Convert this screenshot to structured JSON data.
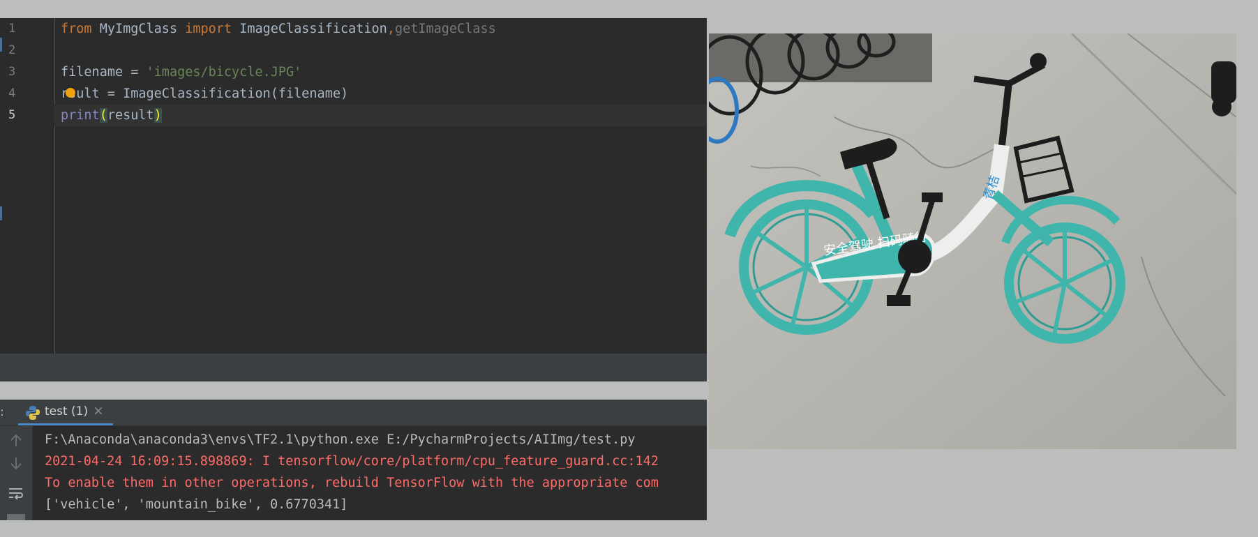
{
  "editor": {
    "line_numbers": [
      "1",
      "2",
      "3",
      "4",
      "5"
    ],
    "lines": {
      "l1": {
        "kw_from": "from",
        "module": " MyImgClass ",
        "kw_import": "import",
        "name1": " ImageClassification",
        "comma": ",",
        "name2": "getImageClass"
      },
      "l3": {
        "var": "filename = ",
        "str": "'images/bicycle.JPG'"
      },
      "l4": {
        "pre": "r",
        "rest": "sult = ImageClassification(filename)"
      },
      "l5": {
        "fn": "print",
        "open": "(",
        "arg": "result",
        "close": ")"
      }
    }
  },
  "run_panel": {
    "colon": ":",
    "tab_label": "test (1)",
    "close_glyph": "×",
    "icons": [
      "arrow-up-icon",
      "arrow-down-icon",
      "soft-wrap-icon"
    ],
    "console": [
      {
        "text": "F:\\Anaconda\\anaconda3\\envs\\TF2.1\\python.exe E:/PycharmProjects/AIImg/test.py",
        "type": "normal"
      },
      {
        "text": "2021-04-24 16:09:15.898869: I tensorflow/core/platform/cpu_feature_guard.cc:142",
        "type": "error"
      },
      {
        "text": "To enable them in other operations, rebuild TensorFlow with the appropriate com",
        "type": "error"
      },
      {
        "text": "['vehicle', 'mountain_bike', 0.6770341]",
        "type": "normal"
      }
    ]
  },
  "photo": {
    "subject": "teal shared bicycle on concrete",
    "chain_guard_text": "安全驾驶 扫码骑行",
    "frame_text": "青桔",
    "colors": {
      "teal": "#3fb5ac",
      "ground": "#b9b8b3",
      "white": "#eeeeee"
    }
  }
}
